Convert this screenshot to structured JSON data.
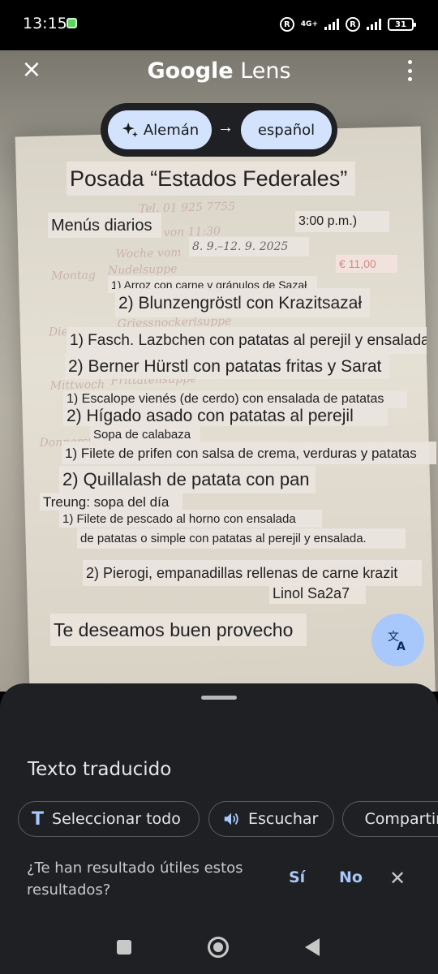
{
  "status_bar": {
    "time": "13:15",
    "network_label": "4G+",
    "roaming_badge": "R",
    "battery": "31"
  },
  "header": {
    "title_brand": "Google",
    "title_product": "Lens"
  },
  "language": {
    "source": "Alemán",
    "target": "español"
  },
  "photo_text": [
    "Tel. 01 925 7755",
    "von 11:30",
    "Woche vom",
    "Montag",
    "Nudelsuppe",
    "€ 11,00",
    "Dienstag",
    "Griessnockerlsuppe",
    "Mittwoch",
    "Frittatensuppe",
    "Donnerstag"
  ],
  "translation": {
    "title": "Posada “Estados Federales”",
    "menu_daily": "Menús diarios",
    "time_until": "3:00 p.m.)",
    "date_range": "8. 9.–12. 9. 2025",
    "price": "€ 11,00",
    "line_mon_1": "1) Arroz con carne y gránulos de Sazał",
    "line_mon_2": "2) Blunzengröstl con Krazitsazał",
    "line_tue_1": "1) Fasch. Lazbchen con patatas al perejil y ensalada",
    "line_tue_2": "2) Berner Hürstl con patatas fritas y Sarat",
    "line_wed_1": "1) Escalope vienés (de cerdo) con ensalada de patatas",
    "line_wed_2": "2) Hígado asado con patatas al perejil",
    "line_thu_soup": "Sopa de calabaza",
    "line_thu_1": "1) Filete de prifen con salsa de crema, verduras y patatas",
    "line_thu_2": "2) Quillalash de patata con pan",
    "line_fri_soup": "Treung: sopa del día",
    "line_fri_1a": "1) Filete de pescado al horno con ensalada",
    "line_fri_1b": "de patatas o simple con patatas al perejil y ensalada.",
    "line_fri_2": "2) Pierogi, empanadillas rellenas de carne krazit",
    "line_fri_2b": "Linol Sa2a7",
    "closing": "Te deseamos buen provecho"
  },
  "sheet": {
    "title": "Texto traducido",
    "select_all": "Seleccionar todo",
    "listen": "Escuchar",
    "share": "Compartir",
    "feedback_question": "¿Te han resultado útiles estos resultados?",
    "yes": "Sí",
    "no": "No"
  },
  "icons": {
    "close": "close-icon",
    "more": "more-vert-icon",
    "sparkle": "sparkle-icon",
    "arrow": "arrow-right-icon",
    "translate": "translate-icon",
    "text": "text-icon",
    "speaker": "speaker-icon",
    "share": "share-icon"
  },
  "colors": {
    "accent": "#a8c7fa",
    "chip_bg": "#d3e3fd",
    "sheet_bg": "#1f2023"
  }
}
